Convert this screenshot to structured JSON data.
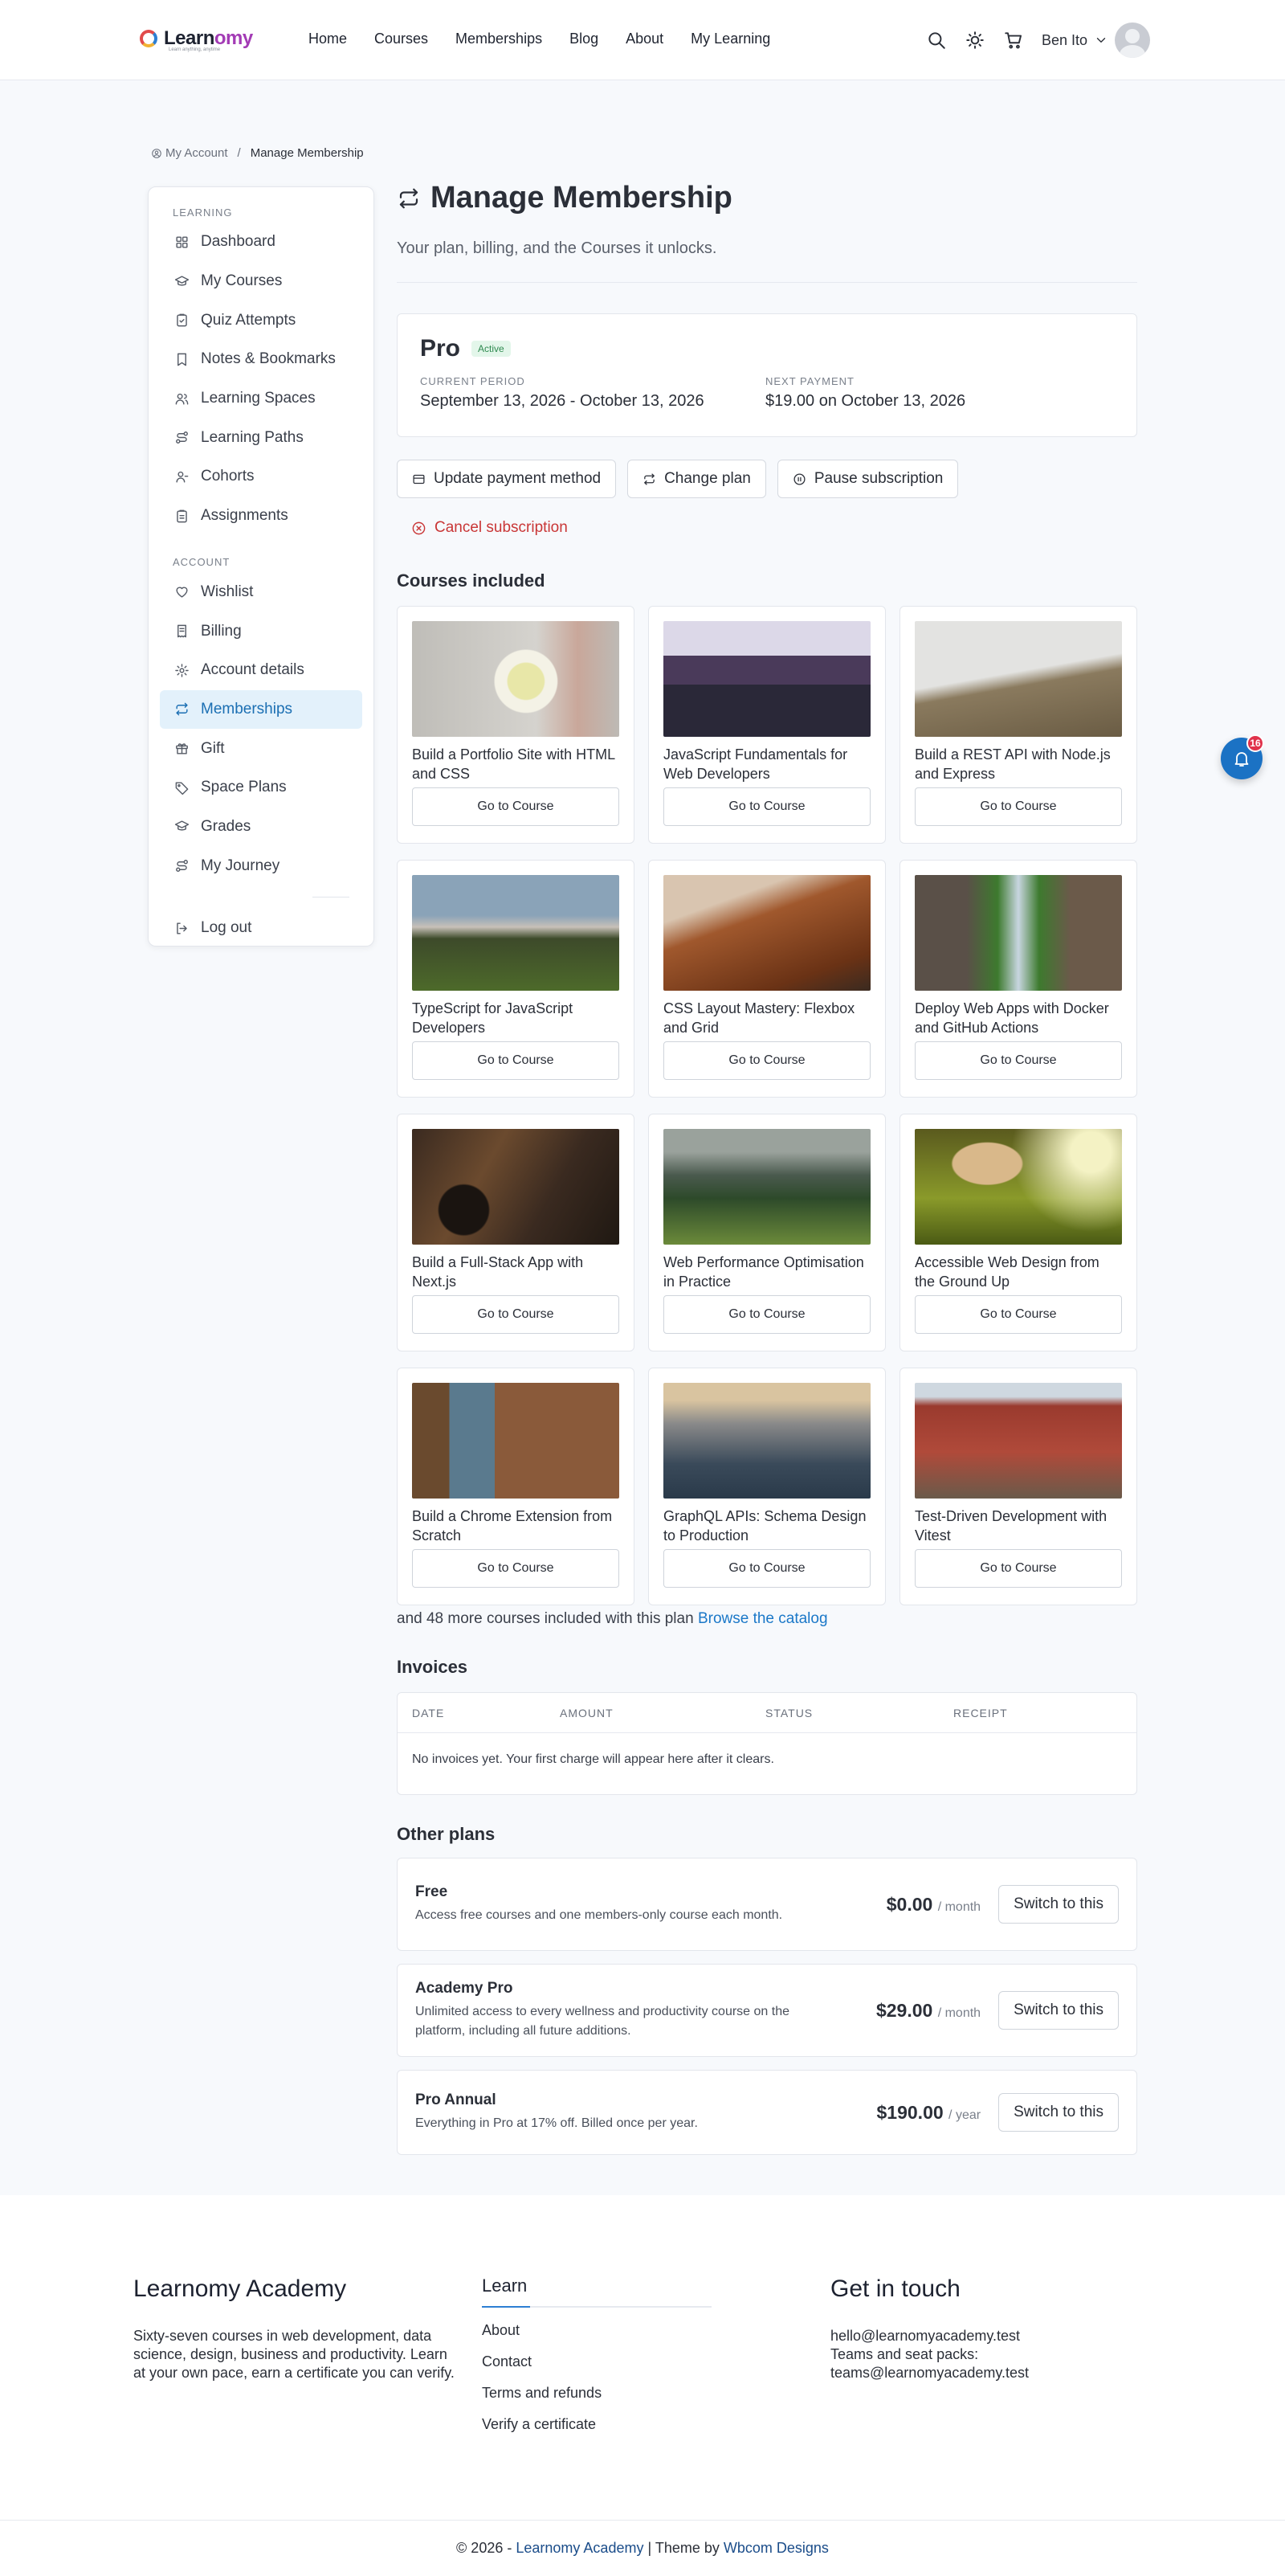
{
  "header": {
    "logo_text": "Learnomy",
    "logo_tagline": "Learn anything, anytime",
    "nav": [
      "Home",
      "Courses",
      "Memberships",
      "Blog",
      "About",
      "My Learning"
    ],
    "user_name": "Ben Ito"
  },
  "breadcrumb": {
    "parent": "My Account",
    "separator": "/",
    "current": "Manage Membership"
  },
  "sidebar": {
    "learning_heading": "LEARNING",
    "learning_items": [
      "Dashboard",
      "My Courses",
      "Quiz Attempts",
      "Notes & Bookmarks",
      "Learning Spaces",
      "Learning Paths",
      "Cohorts",
      "Assignments"
    ],
    "account_heading": "ACCOUNT",
    "account_items": [
      "Wishlist",
      "Billing",
      "Account details",
      "Memberships",
      "Gift",
      "Space Plans",
      "Grades",
      "My Journey"
    ],
    "active_item": "Memberships",
    "logout": "Log out"
  },
  "page": {
    "title": "Manage Membership",
    "subtitle": "Your plan, billing, and the Courses it unlocks."
  },
  "plan": {
    "name": "Pro",
    "status": "Active",
    "current_period_label": "CURRENT PERIOD",
    "current_period": "September 13, 2026 - October 13, 2026",
    "next_payment_label": "NEXT PAYMENT",
    "next_payment": "$19.00 on October 13, 2026"
  },
  "actions": {
    "update_payment": "Update payment method",
    "change_plan": "Change plan",
    "pause": "Pause subscription",
    "cancel": "Cancel subscription"
  },
  "courses_section": {
    "title": "Courses included",
    "button_label": "Go to Course",
    "courses": [
      "Build a Portfolio Site with HTML and CSS",
      "JavaScript Fundamentals for Web Developers",
      "Build a REST API with Node.js and Express",
      "TypeScript for JavaScript Developers",
      "CSS Layout Mastery: Flexbox and Grid",
      "Deploy Web Apps with Docker and GitHub Actions",
      "Build a Full-Stack App with Next.js",
      "Web Performance Optimisation in Practice",
      "Accessible Web Design from the Ground Up",
      "Build a Chrome Extension from Scratch",
      "GraphQL APIs: Schema Design to Production",
      "Test-Driven Development with Vitest"
    ],
    "more_text": "and 48 more courses included with this plan",
    "browse_link": "Browse the catalog"
  },
  "invoices": {
    "title": "Invoices",
    "columns": [
      "DATE",
      "AMOUNT",
      "STATUS",
      "RECEIPT"
    ],
    "empty": "No invoices yet. Your first charge will appear here after it clears."
  },
  "other_plans": {
    "title": "Other plans",
    "button_label": "Switch to this",
    "plans": [
      {
        "name": "Free",
        "description": "Access free courses and one members-only course each month.",
        "price": "$0.00",
        "period": "/ month"
      },
      {
        "name": "Academy Pro",
        "description": "Unlimited access to every wellness and productivity course on the platform, including all future additions.",
        "price": "$29.00",
        "period": "/ month"
      },
      {
        "name": "Pro Annual",
        "description": "Everything in Pro at 17% off. Billed once per year.",
        "price": "$190.00",
        "period": "/ year"
      }
    ]
  },
  "notifications": {
    "count": "16"
  },
  "footer": {
    "about_title": "Learnomy Academy",
    "about_text": "Sixty-seven courses in web development, data science, design, business and productivity. Learn at your own pace, earn a certificate you can verify.",
    "learn_title": "Learn",
    "learn_links": [
      "About",
      "Contact",
      "Terms and refunds",
      "Verify a certificate"
    ],
    "contact_title": "Get in touch",
    "contact_email": "hello@learnomyacademy.test",
    "contact_teams_label": "Teams and seat packs:",
    "contact_teams_email": "teams@learnomyacademy.test",
    "copyright_prefix": "© 2026 -",
    "copyright_brand": "Learnomy Academy",
    "theme_prefix": "| Theme by",
    "theme_brand": "Wbcom Designs"
  }
}
